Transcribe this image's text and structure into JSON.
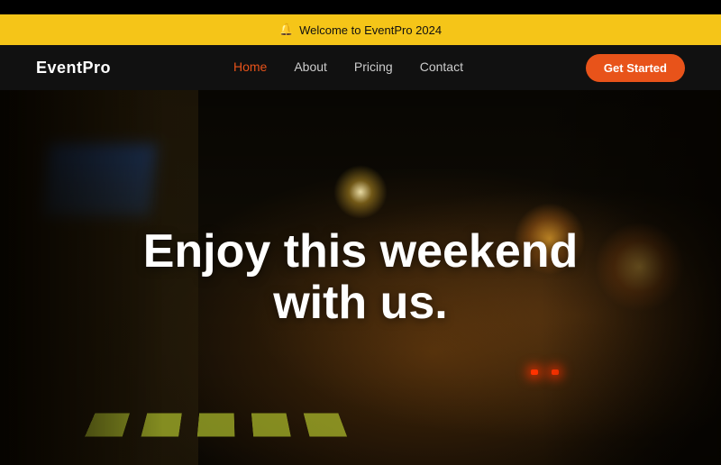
{
  "announcement": {
    "icon": "🔔",
    "text": "Welcome to EventPro 2024"
  },
  "navbar": {
    "logo": "EventPro",
    "links": [
      {
        "label": "Home",
        "active": true
      },
      {
        "label": "About",
        "active": false
      },
      {
        "label": "Pricing",
        "active": false
      },
      {
        "label": "Contact",
        "active": false
      }
    ],
    "cta_label": "Get Started"
  },
  "hero": {
    "title_line1": "Enjoy this weekend",
    "title_line2": "with us."
  }
}
